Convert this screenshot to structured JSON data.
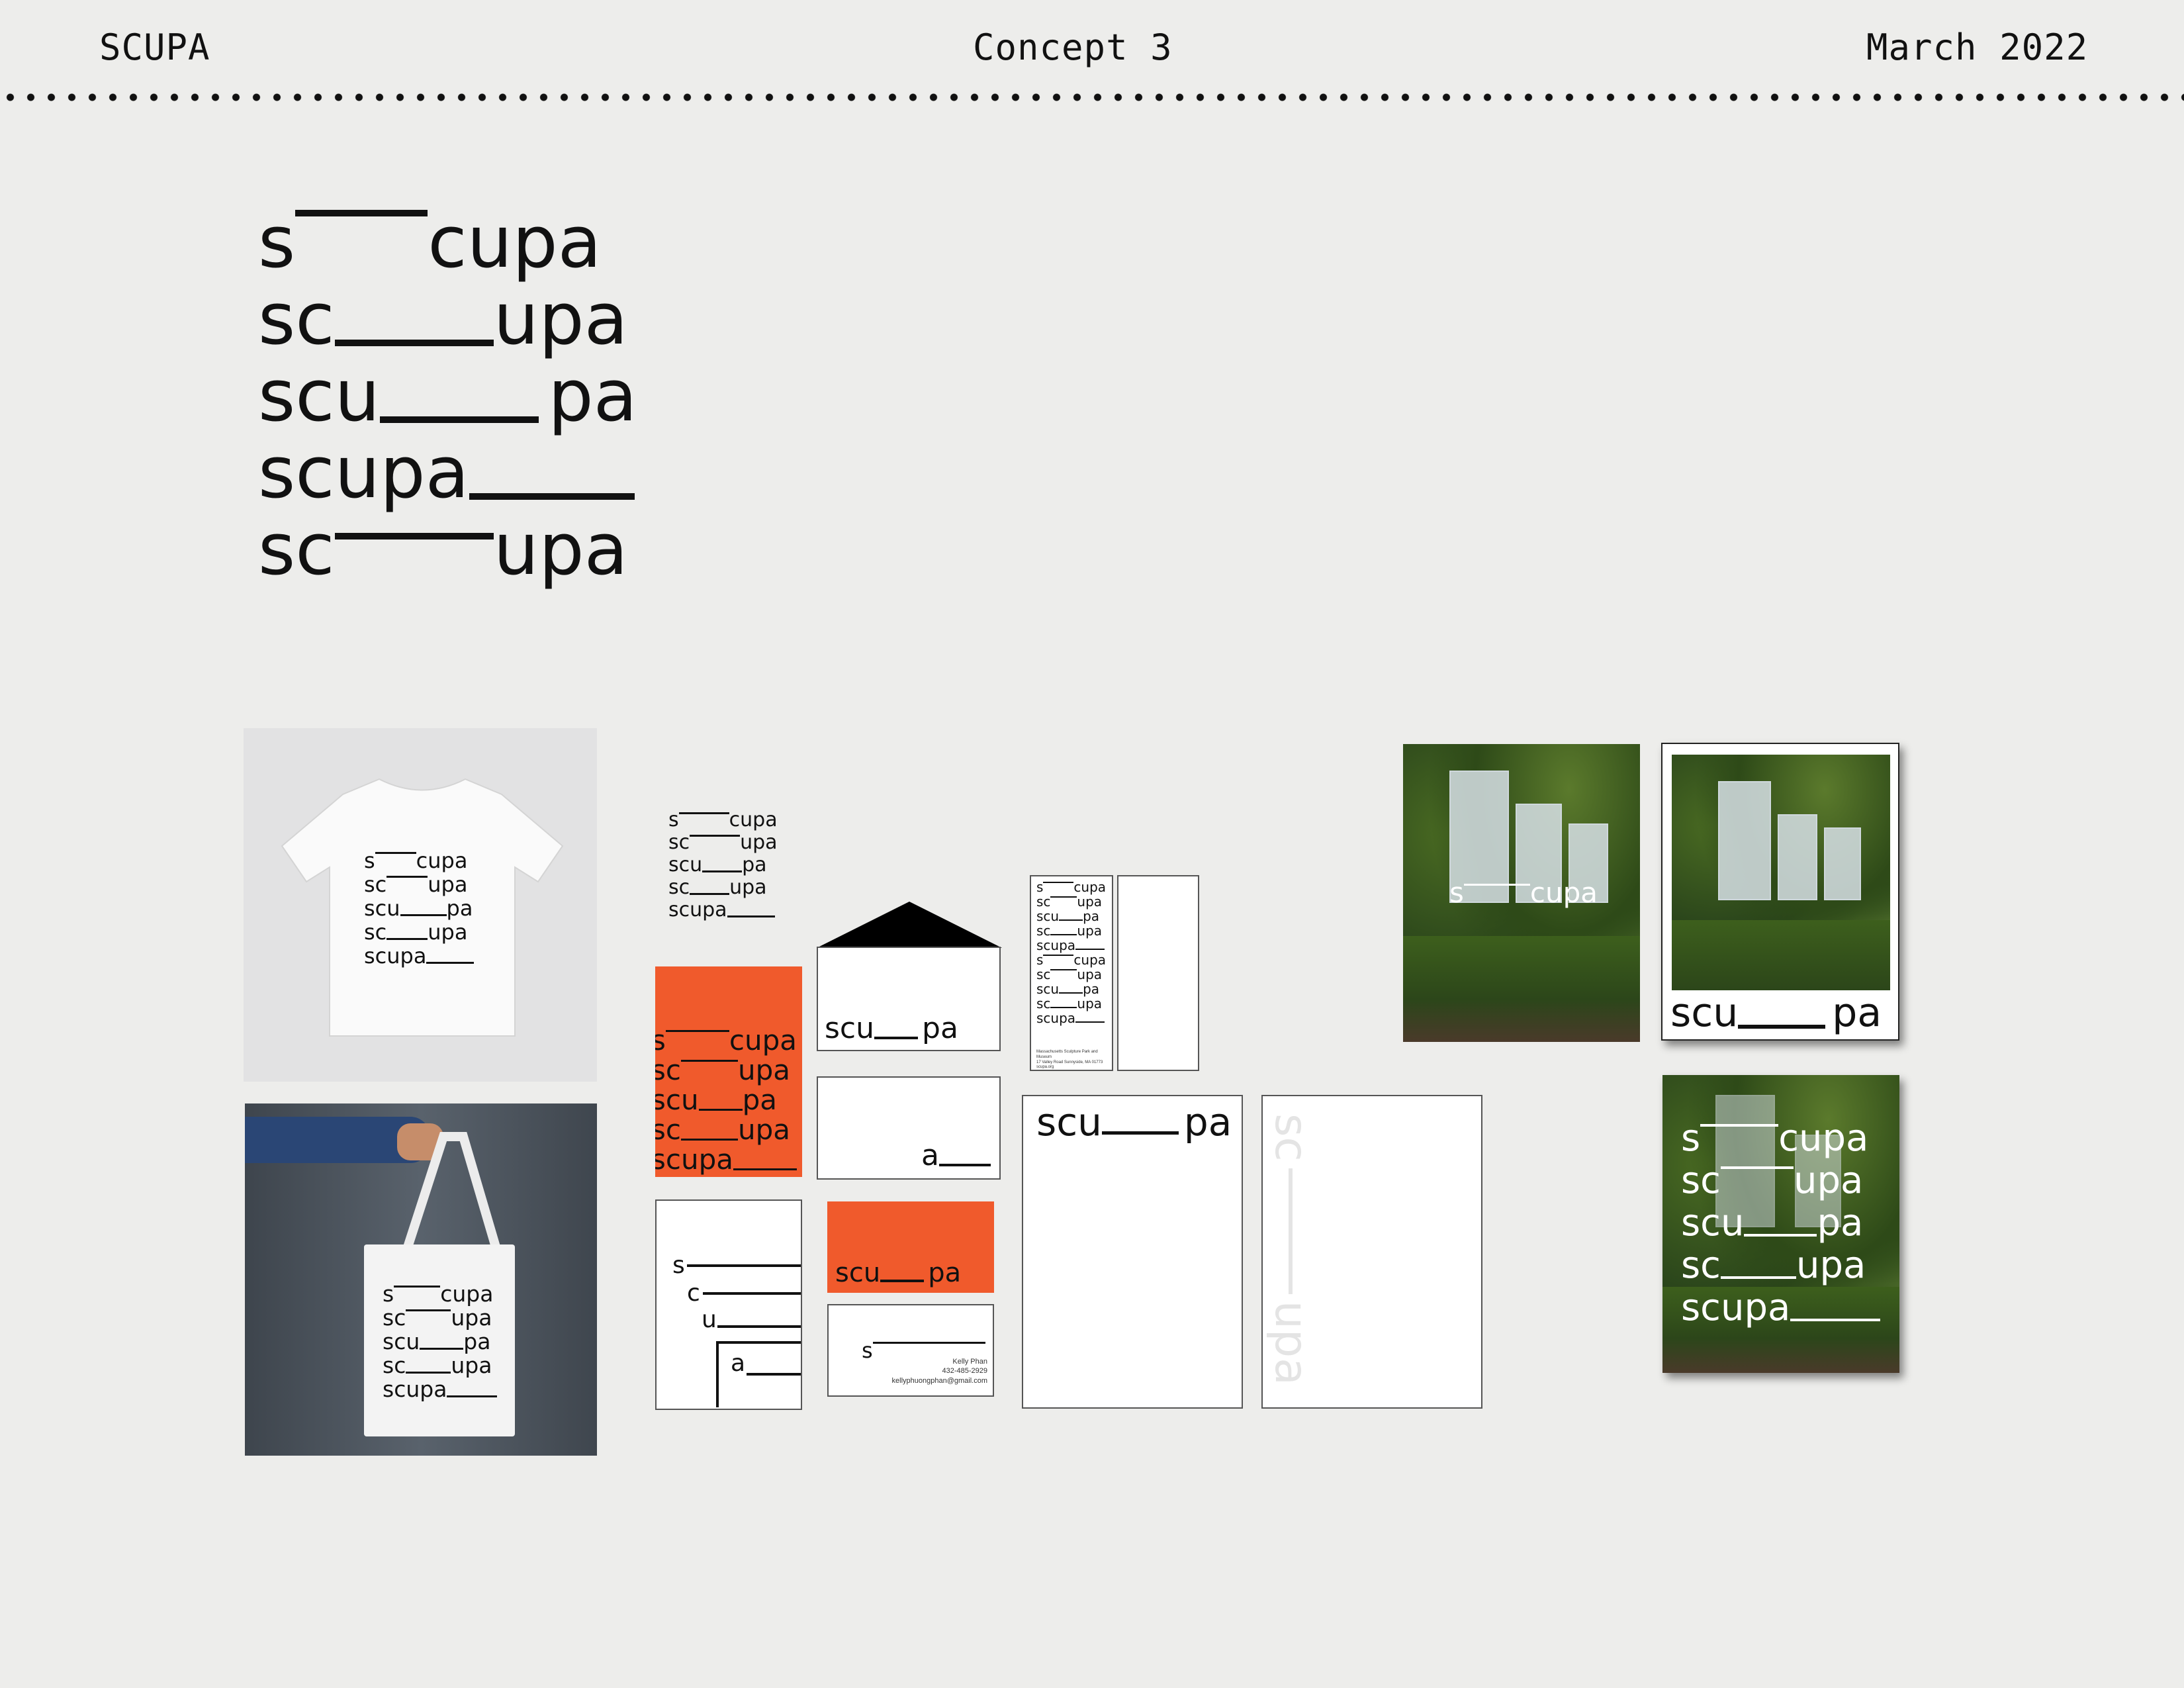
{
  "header": {
    "left": "SCUPA",
    "center": "Concept 3",
    "right": "March 2022"
  },
  "logo": {
    "lines": [
      {
        "pre": "s",
        "post": "cupa"
      },
      {
        "pre": "sc",
        "post": "upa"
      },
      {
        "pre": "scu",
        "post": "pa"
      },
      {
        "pre": "scupa",
        "post": ""
      },
      {
        "pre": "sc",
        "post": "upa"
      }
    ]
  },
  "stack": [
    {
      "pre": "s",
      "post": "cupa"
    },
    {
      "pre": "sc",
      "post": "upa"
    },
    {
      "pre": "scu",
      "post": "pa"
    },
    {
      "pre": "sc",
      "post": "upa"
    },
    {
      "pre": "scupa",
      "post": ""
    }
  ],
  "split": {
    "pre": "scu",
    "post": "pa"
  },
  "envelope_back": {
    "letter": "a"
  },
  "letterhead_cascade": {
    "letters": [
      "s",
      "c",
      "u",
      "a"
    ]
  },
  "vertical": {
    "pre": "sc",
    "post": "upa"
  },
  "business_card": {
    "letter": "s",
    "name": "Kelly Phan",
    "phone": "432-485-2929",
    "email": "kellyphuongphan@gmail.com"
  },
  "bookmark_footer": {
    "line1": "Massachusetts Sculpture Park and Museum",
    "line2": "17 Valley Road Sunnyside, MA 01773",
    "line3": "scupa.org"
  },
  "poster1": {
    "pre": "s",
    "post": "cupa"
  },
  "colors": {
    "orange": "#f05a2c",
    "background": "#ededeb"
  }
}
